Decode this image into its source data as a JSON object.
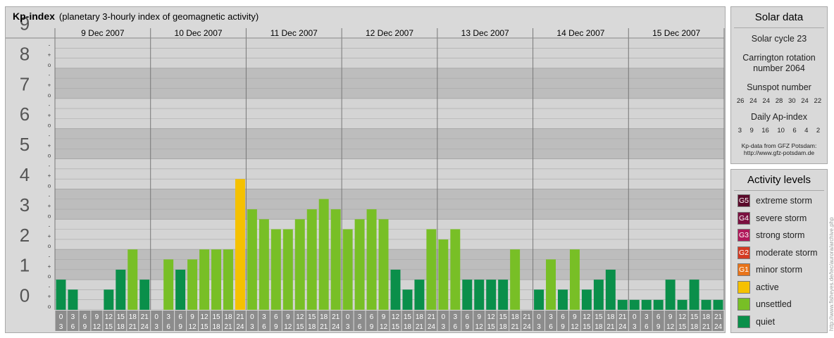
{
  "header": {
    "title": "Kp-index",
    "subtitle": "(planetary 3-hourly index of geomagnetic activity)"
  },
  "chart_data": {
    "type": "bar",
    "ylim": [
      0,
      9
    ],
    "y_ticks": [
      "0",
      "1",
      "2",
      "3",
      "4",
      "5",
      "6",
      "7",
      "8",
      "9"
    ],
    "sub_ticks": [
      "o",
      "+",
      "-"
    ],
    "days": [
      "9 Dec 2007",
      "10 Dec 2007",
      "11 Dec 2007",
      "12 Dec 2007",
      "13 Dec 2007",
      "14 Dec 2007",
      "15 Dec 2007"
    ],
    "interval_labels": [
      [
        "0",
        "3"
      ],
      [
        "3",
        "6"
      ],
      [
        "6",
        "9"
      ],
      [
        "9",
        "12"
      ],
      [
        "12",
        "15"
      ],
      [
        "15",
        "18"
      ],
      [
        "18",
        "21"
      ],
      [
        "21",
        "24"
      ]
    ],
    "values": [
      1.0,
      0.67,
      0,
      0,
      0.67,
      1.33,
      2.0,
      1.0,
      0,
      1.67,
      1.33,
      1.67,
      2.0,
      2.0,
      2.0,
      4.33,
      3.33,
      3.0,
      2.67,
      2.67,
      3.0,
      3.33,
      3.67,
      3.33,
      2.67,
      3.0,
      3.33,
      3.0,
      1.33,
      0.67,
      1.0,
      2.67,
      2.33,
      2.67,
      1.0,
      1.0,
      1.0,
      1.0,
      2.0,
      0,
      0.67,
      1.67,
      0.67,
      2.0,
      0.67,
      1.0,
      1.33,
      0.33,
      0.33,
      0.33,
      0.33,
      1.0,
      0.33,
      1.0,
      0.33,
      0.33
    ],
    "colors": {
      "quiet": "#0a8f4a",
      "unsettled": "#78bf26",
      "active": "#f5c100"
    }
  },
  "solar": {
    "title": "Solar data",
    "cycle": "Solar cycle 23",
    "carrington": "Carrington rotation number 2064",
    "sunspot_title": "Sunspot number",
    "sunspot_values": [
      "26",
      "24",
      "24",
      "28",
      "30",
      "24",
      "22"
    ],
    "ap_title": "Daily Ap-index",
    "ap_values": [
      "3",
      "9",
      "16",
      "10",
      "6",
      "4",
      "2"
    ],
    "credit_line1": "Kp-data from GFZ Potsdam:",
    "credit_line2": "http://www.gfz-potsdam.de"
  },
  "levels": {
    "title": "Activity levels",
    "items": [
      {
        "code": "G5",
        "label": "extreme storm",
        "color": "#5a0a2a"
      },
      {
        "code": "G4",
        "label": "severe storm",
        "color": "#7a1040"
      },
      {
        "code": "G3",
        "label": "strong storm",
        "color": "#b0185a"
      },
      {
        "code": "G2",
        "label": "moderate storm",
        "color": "#d43a22"
      },
      {
        "code": "G1",
        "label": "minor storm",
        "color": "#e8741a"
      },
      {
        "code": "",
        "label": "active",
        "color": "#f5c100"
      },
      {
        "code": "",
        "label": "unsettled",
        "color": "#78bf26"
      },
      {
        "code": "",
        "label": "quiet",
        "color": "#0a8f4a"
      }
    ]
  },
  "watermark": "http://www.fisheyes.de/tec/aurora/archive.php"
}
